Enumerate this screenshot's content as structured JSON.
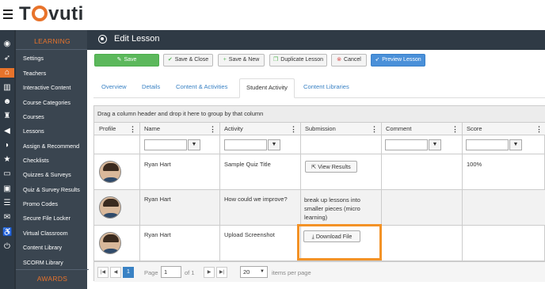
{
  "brand": {
    "logo_text_before": "T",
    "logo_text_after": "vuti",
    "accent": "#e8732b"
  },
  "icon_rail": [
    "dashboard-icon",
    "rocket-icon",
    "graduation-cap-icon",
    "bar-chart-icon",
    "users-icon",
    "trophy-icon",
    "megaphone-icon",
    "rss-icon",
    "star-icon",
    "credit-card-icon",
    "id-badge-icon",
    "list-icon",
    "chat-icon",
    "accessibility-icon",
    "power-icon"
  ],
  "sidebar": {
    "section_learning": "LEARNING",
    "section_awards": "AWARDS",
    "items": [
      "Settings",
      "Teachers",
      "Interactive Content",
      "Course Categories",
      "Courses",
      "Lessons",
      "Assign & Recommend",
      "Checklists",
      "Quizzes & Surveys",
      "Quiz & Survey Results",
      "Promo Codes",
      "Secure File Locker",
      "Virtual Classroom",
      "Content Library",
      "SCORM Library"
    ]
  },
  "header": {
    "title": "Edit Lesson"
  },
  "toolbar": {
    "save": "Save",
    "save_close": "Save & Close",
    "save_new": "Save & New",
    "duplicate": "Duplicate Lesson",
    "cancel": "Cancel",
    "preview": "Preview Lesson"
  },
  "tabs": [
    {
      "label": "Overview",
      "active": false
    },
    {
      "label": "Details",
      "active": false
    },
    {
      "label": "Content & Activities",
      "active": false
    },
    {
      "label": "Student Activity",
      "active": true
    },
    {
      "label": "Content Libraries",
      "active": false
    }
  ],
  "grid": {
    "group_hint": "Drag a column header and drop it here to group by that column",
    "columns": [
      "Profile",
      "Name",
      "Activity",
      "Submission",
      "Comment",
      "Score"
    ],
    "rows": [
      {
        "name": "Ryan Hart",
        "activity": "Sample Quiz Title",
        "submission_button": "View Results",
        "submission_text": "",
        "comment": "",
        "score": "100%"
      },
      {
        "name": "Ryan Hart",
        "activity": "How could we improve?",
        "submission_button": "",
        "submission_text": "break up lessons into smaller pieces (micro learning)",
        "comment": "",
        "score": ""
      },
      {
        "name": "Ryan Hart",
        "activity": "Upload Screenshot",
        "submission_button": "Download File",
        "submission_text": "",
        "comment": "",
        "score": ""
      }
    ],
    "highlight_color": "#f39226"
  },
  "pager": {
    "current_page": "1",
    "page_label": "Page",
    "page_value": "1",
    "of_label": "of 1",
    "page_size": "20",
    "items_per_page": "items per page"
  }
}
